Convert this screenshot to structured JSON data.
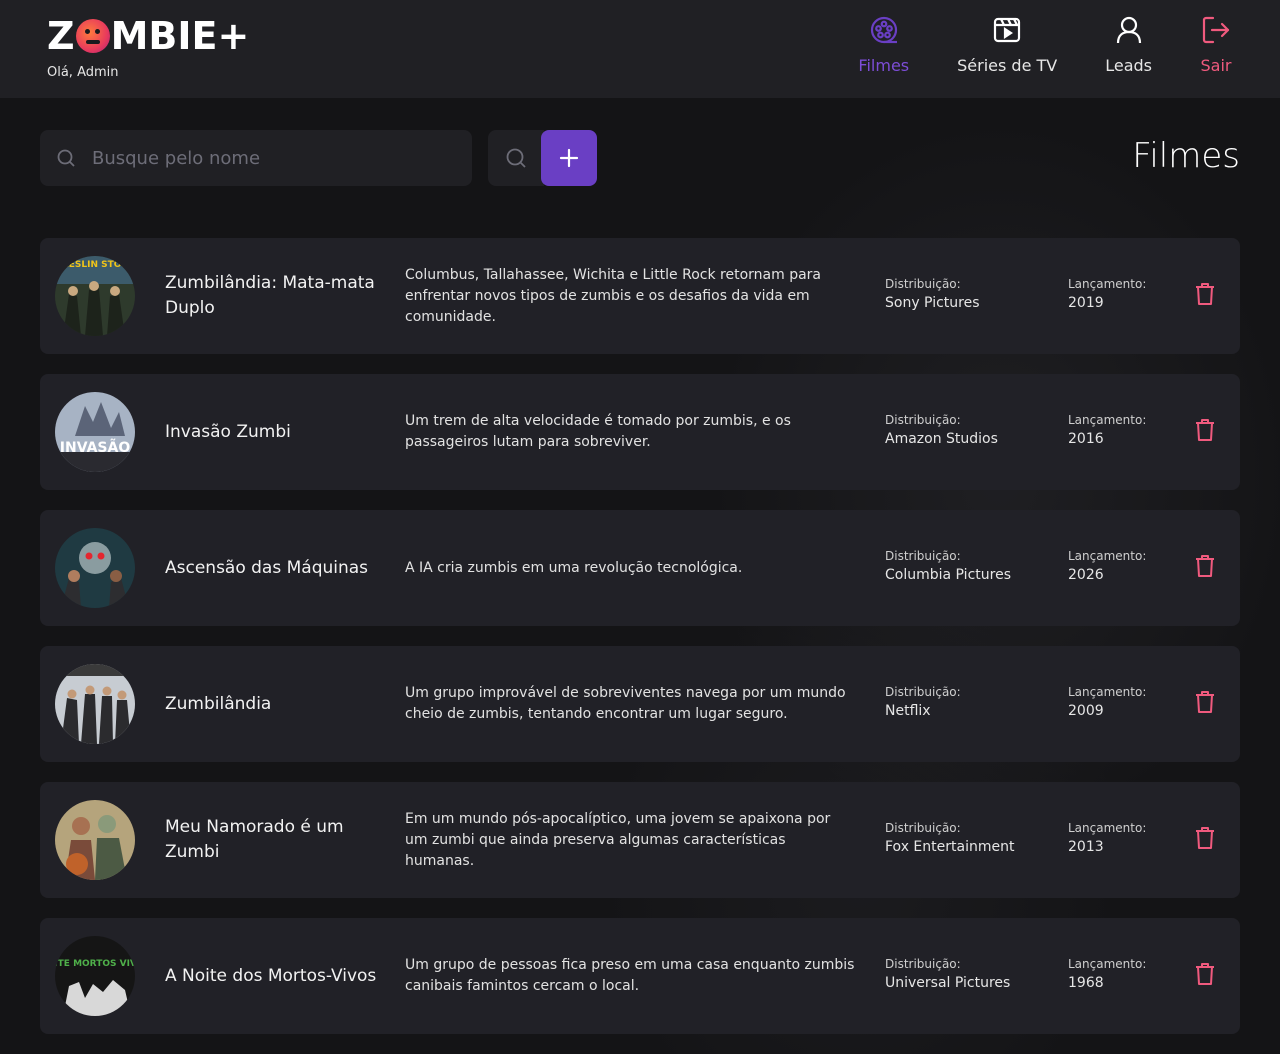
{
  "header": {
    "logo_prefix": "Z",
    "logo_suffix": "MBIE+",
    "greeting": "Olá, Admin",
    "nav": [
      {
        "label": "Filmes",
        "icon": "film-reel-icon",
        "active": true
      },
      {
        "label": "Séries de TV",
        "icon": "clapperboard-icon",
        "active": false
      },
      {
        "label": "Leads",
        "icon": "user-icon",
        "active": false
      },
      {
        "label": "Sair",
        "icon": "logout-icon",
        "active": false
      }
    ]
  },
  "toolbar": {
    "search_placeholder": "Busque pelo nome",
    "search_value": "",
    "search_button_icon": "search-icon",
    "add_button_icon": "plus-icon",
    "page_title": "Filmes"
  },
  "labels": {
    "distribution": "Distribuição:",
    "release": "Lançamento:"
  },
  "colors": {
    "accent": "#6a3fc4",
    "accent_text": "#7c4dd6",
    "danger": "#f05a7e",
    "background": "#141416",
    "card": "#212127",
    "header": "#202024"
  },
  "movies": [
    {
      "title": "Zumbilândia: Mata-mata Duplo",
      "overview": "Columbus, Tallahassee, Wichita e Little Rock retornam para enfrentar novos tipos de zumbis e os desafios da vida em comunidade.",
      "distribution": "Sony Pictures",
      "release": "2019",
      "poster_text": "BRESLIN STONE"
    },
    {
      "title": "Invasão Zumbi",
      "overview": "Um trem de alta velocidade é tomado por zumbis, e os passageiros lutam para sobreviver.",
      "distribution": "Amazon Studios",
      "release": "2016",
      "poster_text": "INVASÃO"
    },
    {
      "title": "Ascensão das Máquinas",
      "overview": "A IA cria zumbis em uma revolução tecnológica.",
      "distribution": "Columbia Pictures",
      "release": "2026",
      "poster_text": ""
    },
    {
      "title": "Zumbilândia",
      "overview": "Um grupo improvável de sobreviventes navega por um mundo cheio de zumbis, tentando encontrar um lugar seguro.",
      "distribution": "Netflix",
      "release": "2009",
      "poster_text": ""
    },
    {
      "title": "Meu Namorado é um Zumbi",
      "overview": "Em um mundo pós-apocalíptico, uma jovem se apaixona por um zumbi que ainda preserva algumas características humanas.",
      "distribution": "Fox Entertainment",
      "release": "2013",
      "poster_text": ""
    },
    {
      "title": "A Noite dos Mortos-Vivos",
      "overview": "Um grupo de pessoas fica preso em uma casa enquanto zumbis canibais famintos cercam o local.",
      "distribution": "Universal Pictures",
      "release": "1968",
      "poster_text": "NOITE MORTOS VIVOS"
    }
  ]
}
